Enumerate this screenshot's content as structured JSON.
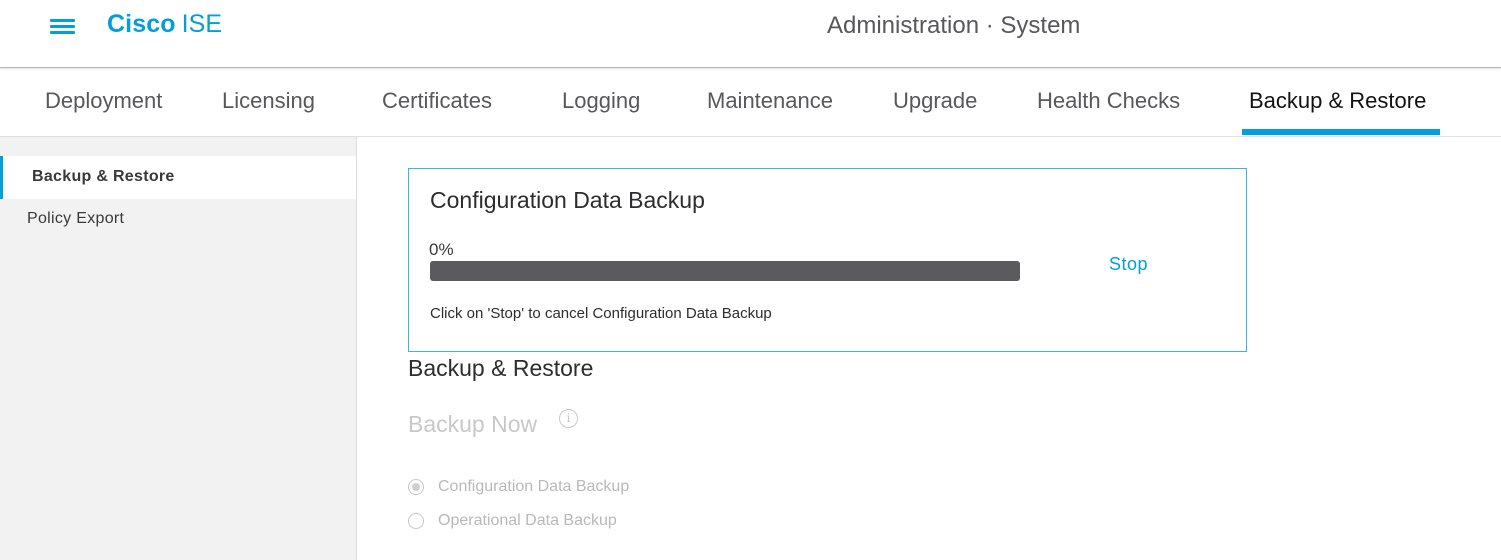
{
  "header": {
    "brand_bold": "Cisco",
    "brand_light": "ISE",
    "context": "Administration · System"
  },
  "tabs": [
    {
      "label": "Deployment",
      "active": false
    },
    {
      "label": "Licensing",
      "active": false
    },
    {
      "label": "Certificates",
      "active": false
    },
    {
      "label": "Logging",
      "active": false
    },
    {
      "label": "Maintenance",
      "active": false
    },
    {
      "label": "Upgrade",
      "active": false
    },
    {
      "label": "Health Checks",
      "active": false
    },
    {
      "label": "Backup & Restore",
      "active": true
    }
  ],
  "sidebar": {
    "items": [
      {
        "label": "Backup & Restore",
        "active": true
      },
      {
        "label": "Policy Export",
        "active": false
      }
    ]
  },
  "progress_panel": {
    "title": "Configuration Data Backup",
    "percent_label": "0%",
    "percent": 0,
    "stop_label": "Stop",
    "hint": "Click on 'Stop' to cancel Configuration Data Backup"
  },
  "section": {
    "title": "Backup & Restore",
    "subtitle": "Backup Now",
    "info_icon": "info-icon",
    "options": [
      {
        "label": "Configuration Data Backup",
        "checked": true,
        "disabled": true
      },
      {
        "label": "Operational Data Backup",
        "checked": false,
        "disabled": true
      }
    ]
  },
  "colors": {
    "accent": "#049fd9",
    "progress_track": "#5b5b5e",
    "disabled_text": "#b9b9b9"
  }
}
